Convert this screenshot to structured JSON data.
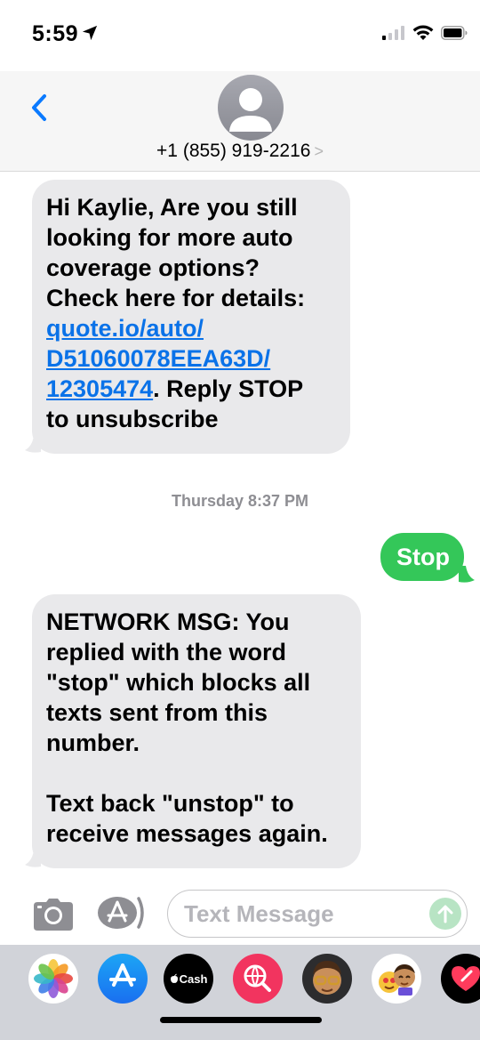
{
  "status": {
    "time": "5:59",
    "location_icon": "location-arrow-icon"
  },
  "header": {
    "contact": "+1 (855) 919-2216",
    "chevron": ">"
  },
  "messages": [
    {
      "direction": "incoming",
      "lines": [
        "Hi Kaylie, Are you still",
        "looking for more auto",
        "coverage options?",
        "Check here for details:"
      ],
      "link_lines": [
        "quote.io/auto/",
        "D51060078EEA63D/",
        "12305474"
      ],
      "after_link": ". Reply STOP",
      "final_line": "to unsubscribe"
    },
    {
      "direction": "outgoing",
      "text": "Stop"
    },
    {
      "direction": "incoming",
      "lines": [
        "NETWORK MSG: You",
        "replied with the word",
        "\"stop\" which blocks all",
        "texts sent from this",
        "number."
      ],
      "lines2": [
        "Text back \"unstop\" to",
        "receive messages again."
      ]
    }
  ],
  "timestamp": {
    "day": "Thursday",
    "time": "8:37 PM"
  },
  "composer": {
    "placeholder": "Text Message"
  },
  "app_drawer": {
    "cash_label": "Cash"
  },
  "colors": {
    "outgoing_bubble": "#34c759",
    "incoming_bubble": "#e9e9eb",
    "link": "#0a72e8",
    "back_arrow": "#0a7aff"
  }
}
